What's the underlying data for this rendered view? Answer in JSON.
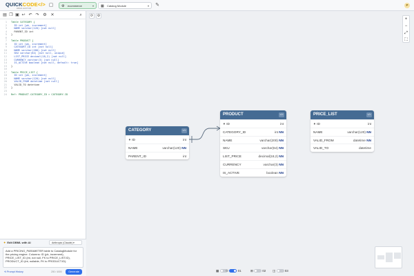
{
  "topbar": {
    "logo_main": "QUICK",
    "logo_accent": "CODE</>",
    "logo_tagline": "DBML EDITOR",
    "project_tab": "ecommerce",
    "module_tab": "Catalog Module",
    "avatar_initial": "P"
  },
  "code": {
    "lines": [
      {
        "n": "1",
        "t": "Table CATEGORY {"
      },
      {
        "n": "2",
        "t": "  ID int [pk, increment]"
      },
      {
        "n": "3",
        "t": "  NAME varchar(120) [not null]"
      },
      {
        "n": "4",
        "t": "  PARENT_ID int"
      },
      {
        "n": "5",
        "t": "}"
      },
      {
        "n": "6",
        "t": ""
      },
      {
        "n": "7",
        "t": "Table PRODUCT {"
      },
      {
        "n": "8",
        "t": "  ID int [pk, increment]"
      },
      {
        "n": "9",
        "t": "  CATEGORY_ID int [not null]"
      },
      {
        "n": "10",
        "t": "  NAME varchar(200) [not null]"
      },
      {
        "n": "11",
        "t": "  SKU varchar(64) [not null, unique]"
      },
      {
        "n": "12",
        "t": "  LIST_PRICE decimal(18,2) [not null]"
      },
      {
        "n": "13",
        "t": "  CURRENCY varchar(3) [not null]"
      },
      {
        "n": "14",
        "t": "  IS_ACTIVE boolean [not null, default: true]"
      },
      {
        "n": "15",
        "t": "}"
      },
      {
        "n": "16",
        "t": ""
      },
      {
        "n": "17",
        "t": "Table PRICE_LIST {"
      },
      {
        "n": "18",
        "t": "  ID int [pk, increment]"
      },
      {
        "n": "19",
        "t": "  NAME varchar(120) [not null]"
      },
      {
        "n": "20",
        "t": "  VALID_FROM datetime [not null]"
      },
      {
        "n": "21",
        "t": "  VALID_TO datetime"
      },
      {
        "n": "22",
        "t": "}"
      },
      {
        "n": "23",
        "t": ""
      },
      {
        "n": "24",
        "t": "Ref: PRODUCT.CATEGORY_ID > CATEGORY.ID"
      }
    ]
  },
  "ai": {
    "title": "Edit DBML with AI",
    "model": "Anthropic (Claude)",
    "prompt": "Add a PRICING_PARAMETER table to CatalogModule for the pricing engine. Columns: ID (pk, increment), PRICE_LIST_ID (int, not null, FK to PRICE_LIST.ID), PRODUCT_ID (int, nullable, FK to PRODUCT.ID).",
    "history": "Prompt History",
    "count": "200 / 4000",
    "generate": "Generate"
  },
  "canvas": {
    "zoom_in": "+",
    "zoom_out": "−",
    "fit": "⤢",
    "tables": {
      "category": {
        "name": "CATEGORY",
        "icon": "</>",
        "rows": [
          {
            "name": "ID",
            "type": "int",
            "pk": true,
            "nn": ""
          },
          {
            "name": "NAME",
            "type": "varchar(120)",
            "pk": false,
            "nn": "NN"
          },
          {
            "name": "PARENT_ID",
            "type": "int",
            "pk": false,
            "nn": ""
          }
        ]
      },
      "product": {
        "name": "PRODUCT",
        "icon": "</>",
        "rows": [
          {
            "name": "ID",
            "type": "int",
            "pk": true,
            "nn": ""
          },
          {
            "name": "CATEGORY_ID",
            "type": "int",
            "pk": false,
            "nn": "NN"
          },
          {
            "name": "NAME",
            "type": "varchar(200)",
            "pk": false,
            "nn": "NN"
          },
          {
            "name": "SKU",
            "type": "varchar(64)",
            "pk": false,
            "nn": "NN"
          },
          {
            "name": "LIST_PRICE",
            "type": "decimal(18,2)",
            "pk": false,
            "nn": "NN"
          },
          {
            "name": "CURRENCY",
            "type": "varchar(3)",
            "pk": false,
            "nn": "NN"
          },
          {
            "name": "IS_ACTIVE",
            "type": "boolean",
            "pk": false,
            "nn": "NN"
          }
        ]
      },
      "price_list": {
        "name": "PRICE_LIST",
        "icon": "</>",
        "rows": [
          {
            "name": "ID",
            "type": "int",
            "pk": true,
            "nn": ""
          },
          {
            "name": "NAME",
            "type": "varchar(120)",
            "pk": false,
            "nn": "NN"
          },
          {
            "name": "VALID_FROM",
            "type": "datetime",
            "pk": false,
            "nn": "NN"
          },
          {
            "name": "VALID_TO",
            "type": "datetime",
            "pk": false,
            "nn": ""
          }
        ]
      }
    },
    "bottom": {
      "c1": "01",
      "c2": "02",
      "c3": "03"
    }
  },
  "colors": {
    "header": "#456b93",
    "accent": "#2f6fea",
    "project_tab_bg": "#e1f1e7"
  }
}
